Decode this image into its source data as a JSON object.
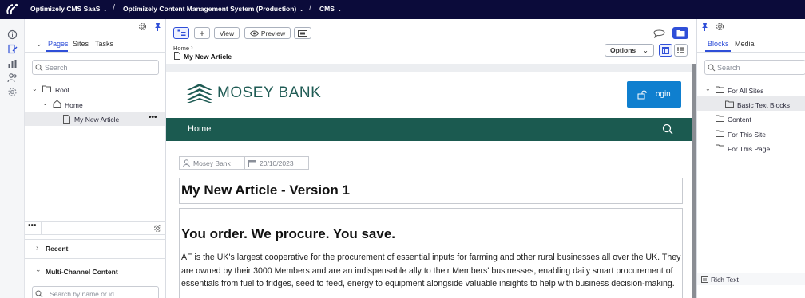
{
  "topbar": {
    "crumbs": [
      {
        "label": "Optimizely CMS SaaS"
      },
      {
        "label": "Optimizely Content Management System (Production)"
      },
      {
        "label": "CMS"
      }
    ]
  },
  "nav_pane": {
    "tabs": [
      "Pages",
      "Sites",
      "Tasks"
    ],
    "search_placeholder": "Search",
    "tree": [
      {
        "label": "Root",
        "icon": "folder-icon"
      },
      {
        "label": "Home",
        "icon": "home-icon"
      },
      {
        "label": "My New Article",
        "icon": "page-icon",
        "selected": true
      }
    ],
    "more_label": "•••",
    "recent_label": "Recent",
    "mcc_label": "Multi-Channel Content",
    "mcc_search_placeholder": "Search by name or id"
  },
  "toolbar": {
    "view_label": "View",
    "preview_label": "Preview",
    "breadcrumb_home": "Home",
    "page_name": "My New Article",
    "options_label": "Options"
  },
  "site": {
    "brand": "MOSEY BANK",
    "login_label": "Login",
    "nav_home": "Home",
    "author": "Mosey Bank",
    "date": "20/10/2023",
    "title": "My New Article - Version 1",
    "heading": "You order. We procure. You save.",
    "body": "AF is the UK's largest cooperative for the procurement of essential inputs for farming and other rural businesses all over the UK. They are owned by their 3000 Members and are an indispensable ally to their Members' businesses, enabling daily smart procurement of essentials from fuel to fridges, seed to feed, energy to equipment alongside valuable insights to help with business decision-making."
  },
  "right_pane": {
    "tabs": [
      "Blocks",
      "Media"
    ],
    "search_placeholder": "Search",
    "tree": [
      {
        "label": "For All Sites"
      },
      {
        "label": "Basic Text Blocks",
        "selected": true
      },
      {
        "label": "Content"
      },
      {
        "label": "For This Site"
      },
      {
        "label": "For This Page"
      }
    ],
    "rich_text_label": "Rich Text"
  },
  "colors": {
    "topbar": "#0b0b3a",
    "accent": "#2f4fd8",
    "brand_green": "#1b5a50",
    "login_blue": "#0f7fcf"
  }
}
